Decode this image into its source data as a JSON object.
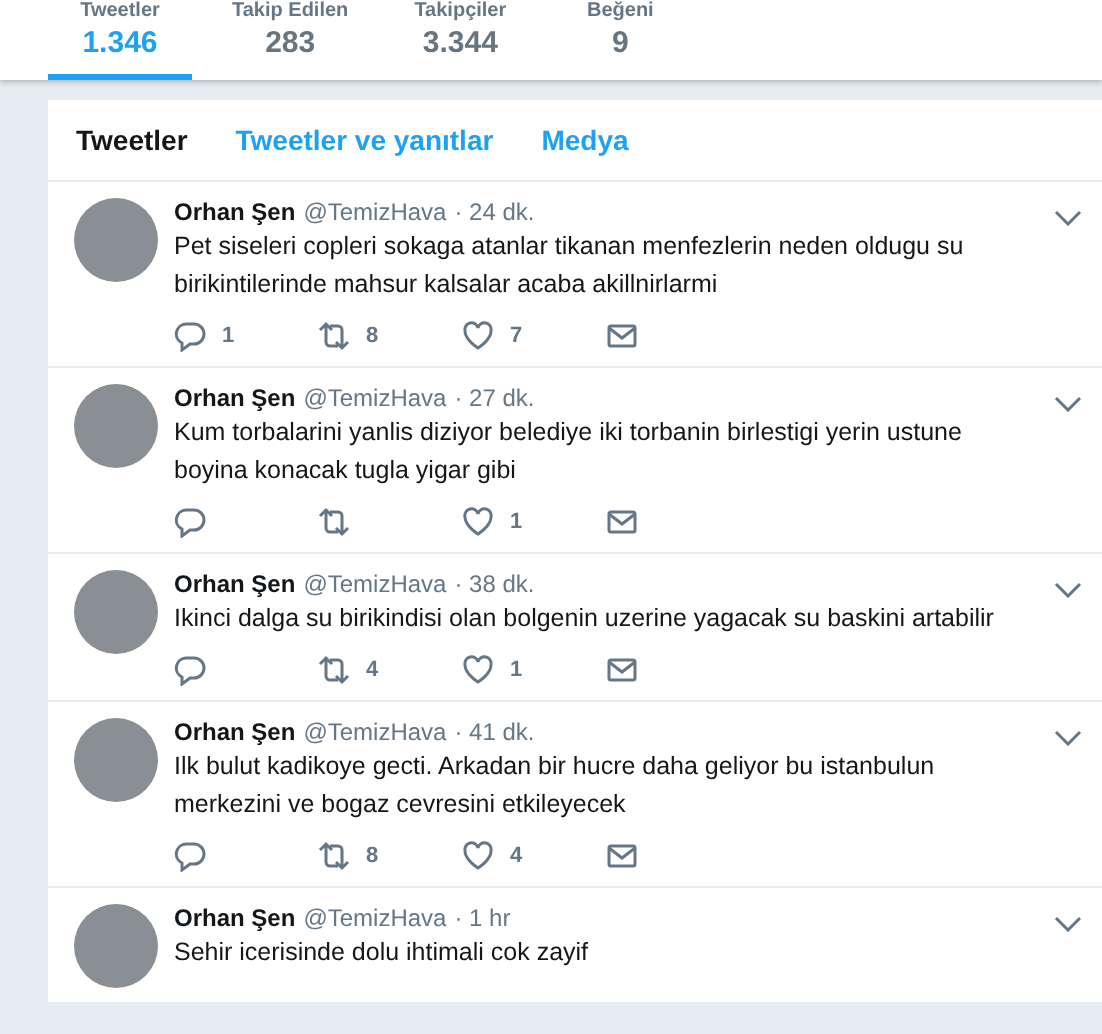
{
  "stats": [
    {
      "label": "Tweetler",
      "value": "1.346",
      "selected": true
    },
    {
      "label": "Takip Edilen",
      "value": "283",
      "selected": false
    },
    {
      "label": "Takipçiler",
      "value": "3.344",
      "selected": false
    },
    {
      "label": "Beğeni",
      "value": "9",
      "selected": false
    }
  ],
  "tabs": [
    {
      "label": "Tweetler",
      "selected": true
    },
    {
      "label": "Tweetler ve yanıtlar",
      "selected": false
    },
    {
      "label": "Medya",
      "selected": false
    }
  ],
  "tweets": [
    {
      "name": "Orhan Şen",
      "handle": "@TemizHava",
      "time": "· 24 dk.",
      "text": "Pet siseleri copleri sokaga atanlar tikanan menfezlerin neden oldugu su birikintilerinde mahsur kalsalar acaba akillnirlarmi",
      "replies": "1",
      "retweets": "8",
      "likes": "7"
    },
    {
      "name": "Orhan Şen",
      "handle": "@TemizHava",
      "time": "· 27 dk.",
      "text": "Kum torbalarini yanlis diziyor belediye iki torbanin birlestigi yerin ustune boyina konacak tugla yigar gibi",
      "likes": "1"
    },
    {
      "name": "Orhan Şen",
      "handle": "@TemizHava",
      "time": "· 38 dk.",
      "text": "Ikinci dalga su birikindisi olan bolgenin uzerine yagacak su baskini artabilir",
      "retweets": "4",
      "likes": "1"
    },
    {
      "name": "Orhan Şen",
      "handle": "@TemizHava",
      "time": "· 41 dk.",
      "text": "Ilk bulut kadikoye gecti. Arkadan bir hucre daha geliyor bu istanbulun merkezini ve bogaz cevresini etkileyecek",
      "retweets": "8",
      "likes": "4"
    },
    {
      "name": "Orhan Şen",
      "handle": "@TemizHava",
      "time": "· 1 hr",
      "text": "Sehir icerisinde dolu ihtimali cok zayif"
    }
  ]
}
